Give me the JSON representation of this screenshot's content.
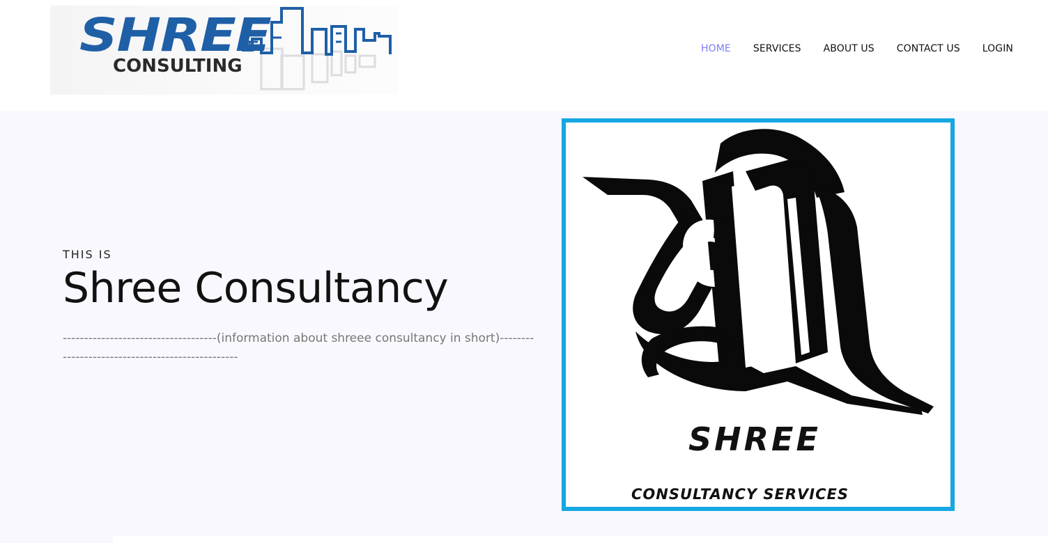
{
  "logo": {
    "main_text": "SHREE",
    "sub_text": "CONSULTING",
    "brand_color": "#1f5fa6"
  },
  "nav": {
    "items": [
      {
        "label": "HOME",
        "active": true
      },
      {
        "label": "SERVICES",
        "active": false
      },
      {
        "label": "ABOUT US",
        "active": false
      },
      {
        "label": "CONTACT US",
        "active": false
      },
      {
        "label": "LOGIN",
        "active": false
      }
    ],
    "active_color": "#7b7ef0"
  },
  "hero": {
    "kicker": "THIS IS",
    "title": "Shree Consultancy",
    "description": "------------------------------------(information about shreee consultancy in short)-------------------------------------------------",
    "image": {
      "caption_main": "SHREE",
      "caption_sub": "CONSULTANCY SERVICES",
      "border_color": "#16a7e2"
    }
  }
}
